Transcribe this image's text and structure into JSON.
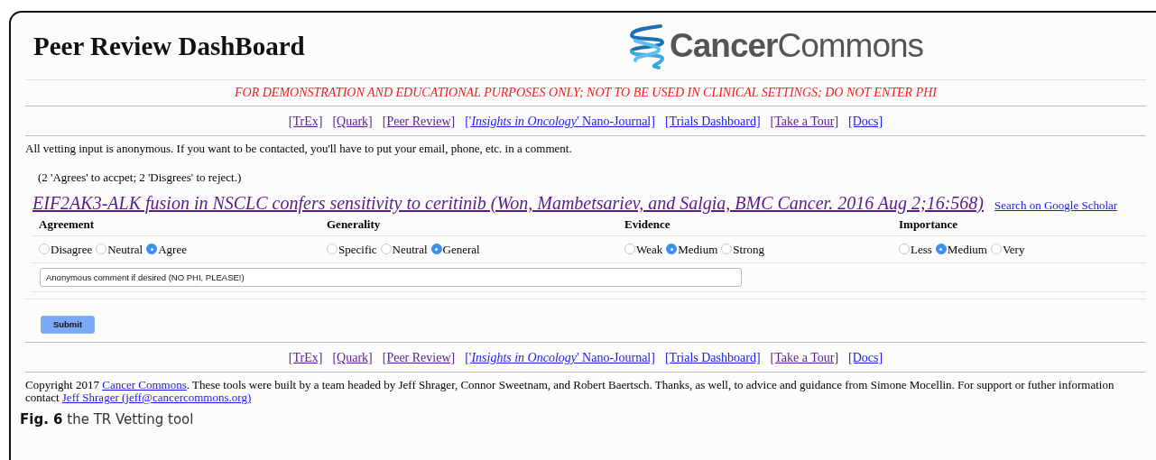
{
  "header": {
    "title": "Peer Review DashBoard",
    "logo_text": "**Cancer**Commons"
  },
  "disclaimer": "FOR DEMONSTRATION AND EDUCATIONAL PURPOSES ONLY; NOT TO BE USED IN CLINICAL SETTINGS; DO NOT ENTER PHI",
  "nav_top": [
    {
      "text": "[TrEx]",
      "visited": true
    },
    {
      "text": "[Quark]",
      "visited": true
    },
    {
      "text": "[Peer Review]",
      "visited": true
    },
    {
      "text": "['*Insights in Oncology*' Nano-Journal]",
      "visited": false
    },
    {
      "text": "[Trials Dashboard]",
      "visited": false
    },
    {
      "text": "[Take a Tour]",
      "visited": true
    },
    {
      "text": "[Docs]",
      "visited": false
    }
  ],
  "notice": "All vetting input is anonymous. If you want to be contacted, you'll have to put your email, phone, etc. in a comment.",
  "rule_note": "(2 'Agrees' to accpet; 2 'Disgrees' to reject.)",
  "article": {
    "title": "EIF2AK3-ALK fusion in NSCLC confers sensitivity to ceritinib (Won, Mambetsariev, and Salgia, BMC Cancer. 2016 Aug 2;16:568)",
    "title_visited": true,
    "scholar_link": "Search on Google Scholar"
  },
  "ratings": [
    {
      "heading": "Agreement",
      "options": [
        {
          "label": "Disagree",
          "selected": false
        },
        {
          "label": "Neutral",
          "selected": false
        },
        {
          "label": "Agree",
          "selected": true
        }
      ]
    },
    {
      "heading": "Generality",
      "options": [
        {
          "label": "Specific",
          "selected": false
        },
        {
          "label": "Neutral",
          "selected": false
        },
        {
          "label": "General",
          "selected": true
        }
      ]
    },
    {
      "heading": "Evidence",
      "options": [
        {
          "label": "Weak",
          "selected": false
        },
        {
          "label": "Medium",
          "selected": true
        },
        {
          "label": "Strong",
          "selected": false
        }
      ]
    },
    {
      "heading": "Importance",
      "options": [
        {
          "label": "Less",
          "selected": false
        },
        {
          "label": "Medium",
          "selected": true
        },
        {
          "label": "Very",
          "selected": false
        }
      ]
    }
  ],
  "comment": {
    "placeholder": "Anonymous comment if desired (NO PHI, PLEASE!)"
  },
  "submit": "Submit",
  "nav_bottom": [
    {
      "text": "[TrEx]",
      "visited": true
    },
    {
      "text": "[Quark]",
      "visited": true
    },
    {
      "text": "[Peer Review]",
      "visited": true
    },
    {
      "text": "['*Insights in Oncology*' Nano-Journal]",
      "visited": false
    },
    {
      "text": "[Trials Dashboard]",
      "visited": false
    },
    {
      "text": "[Take a Tour]",
      "visited": true
    },
    {
      "text": "[Docs]",
      "visited": false
    }
  ],
  "footer": [
    {
      "kind": "text",
      "text": "Copyright 2017 "
    },
    {
      "kind": "link",
      "text": "Cancer Commons",
      "visited": false
    },
    {
      "kind": "text",
      "text": ". These tools were built by a team headed by Jeff Shrager, Connor Sweetnam, and Robert Baertsch. Thanks, as well, to advice and guidance from Simone Mocellin. For support or futher information contact "
    },
    {
      "kind": "link",
      "text": "Jeff Shrager (jeff@cancercommons.org)",
      "visited": false
    }
  ],
  "caption": {
    "label": "Fig. 6",
    "text": "the TR Vetting tool"
  }
}
